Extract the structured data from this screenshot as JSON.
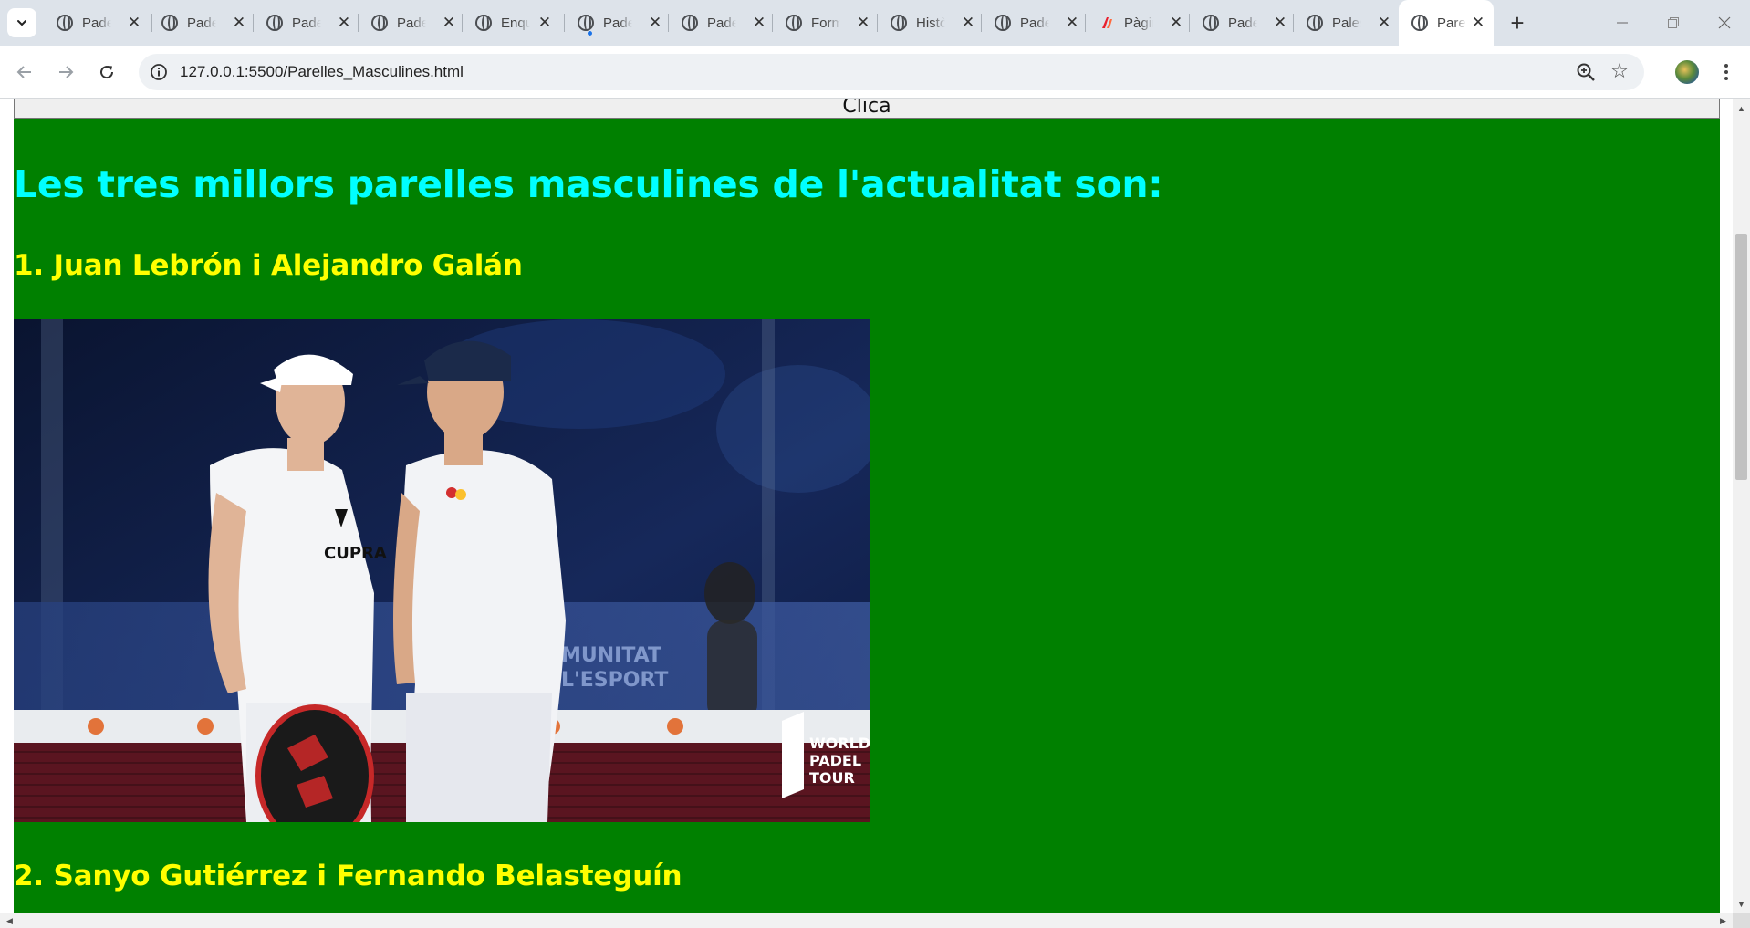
{
  "browser": {
    "tabs": [
      {
        "title": "Padel Pàgina",
        "icon": "globe-icon"
      },
      {
        "title": "Padel Pàgina",
        "icon": "globe-icon"
      },
      {
        "title": "Padel Pàgina",
        "icon": "globe-icon"
      },
      {
        "title": "Padel Pàgina",
        "icon": "globe-icon"
      },
      {
        "title": "Enquesta",
        "icon": "globe-icon"
      },
      {
        "title": "Padel Pàgina",
        "icon": "globe-icon"
      },
      {
        "title": "Padel Pàgina",
        "icon": "globe-icon"
      },
      {
        "title": "Formulari",
        "icon": "globe-icon"
      },
      {
        "title": "Història",
        "icon": "globe-icon"
      },
      {
        "title": "Padel Pàgina",
        "icon": "globe-icon"
      },
      {
        "title": "Pàgina",
        "icon": "laliga-icon"
      },
      {
        "title": "Padel Pàgina",
        "icon": "globe-icon"
      },
      {
        "title": "Pales",
        "icon": "globe-icon"
      },
      {
        "title": "Parelles Masculines",
        "icon": "globe-icon"
      }
    ],
    "active_tab_index": 13,
    "address_bar": {
      "url": "127.0.0.1:5500/Parelles_Masculines.html"
    }
  },
  "page": {
    "button_label": "Clica",
    "heading": "Les tres millors parelles masculines de l'actualitat son:",
    "pairs": [
      {
        "label": "1. Juan Lebrón i Alejandro Galán"
      },
      {
        "label": "2. Sanyo Gutiérrez i Fernando Belasteguín"
      }
    ],
    "photo_1": {
      "shirt_sponsor": "CUPRA",
      "watermark": [
        "WORLD",
        "PADEL",
        "TOUR"
      ],
      "banner_text": [
        "MUNITAT",
        "L'ESPORT"
      ]
    }
  },
  "colors": {
    "page_background": "#008000",
    "heading_color": "#00ffff",
    "pair_heading_color": "#ffff00"
  }
}
